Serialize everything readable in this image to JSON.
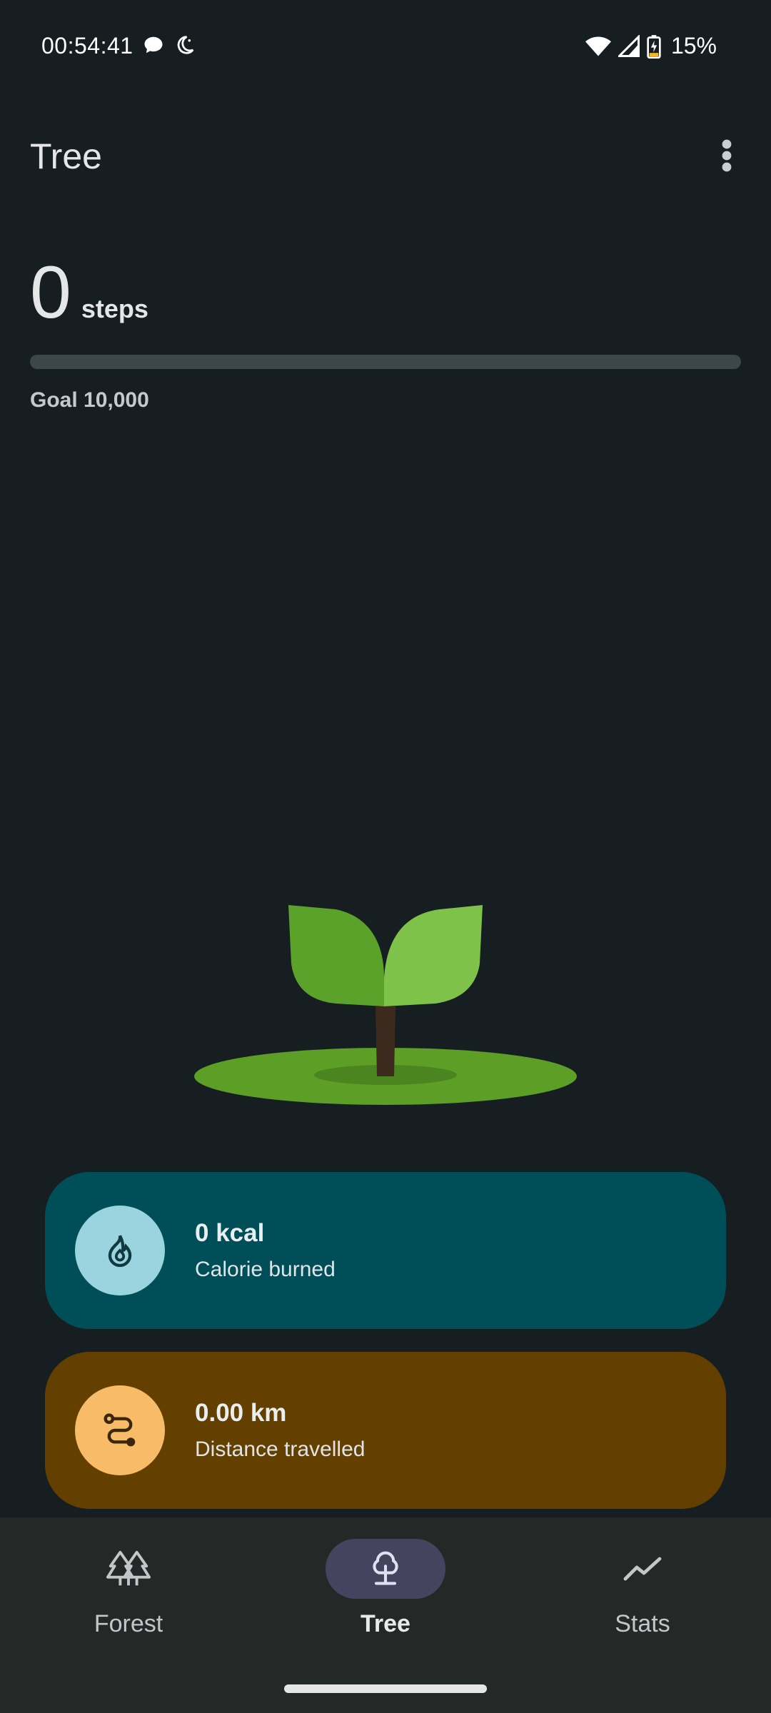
{
  "status_bar": {
    "time": "00:54:41",
    "battery_percent": "15%",
    "icons": [
      "chat-bubble-icon",
      "do-not-disturb-moon-icon",
      "wifi-icon",
      "cell-signal-icon",
      "battery-charging-icon"
    ]
  },
  "app_bar": {
    "title": "Tree",
    "menu_icon": "more-vert-icon"
  },
  "steps": {
    "value": "0",
    "unit": "steps",
    "goal_label": "Goal 10,000",
    "progress_fraction": 0
  },
  "cards": {
    "calorie": {
      "icon": "flame-icon",
      "value": "0 kcal",
      "label": "Calorie burned",
      "color": "#004e58"
    },
    "distance": {
      "icon": "route-icon",
      "value": "0.00 km",
      "label": "Distance travelled",
      "color": "#633f00"
    }
  },
  "bottom_nav": {
    "items": [
      {
        "label": "Forest",
        "icon": "forest-icon",
        "selected": false
      },
      {
        "label": "Tree",
        "icon": "tree-icon",
        "selected": true
      },
      {
        "label": "Stats",
        "icon": "trend-line-icon",
        "selected": false
      }
    ]
  },
  "colors": {
    "background": "#171e22",
    "accent_green": "#7fc24a",
    "nav_selected": "#44445f"
  }
}
